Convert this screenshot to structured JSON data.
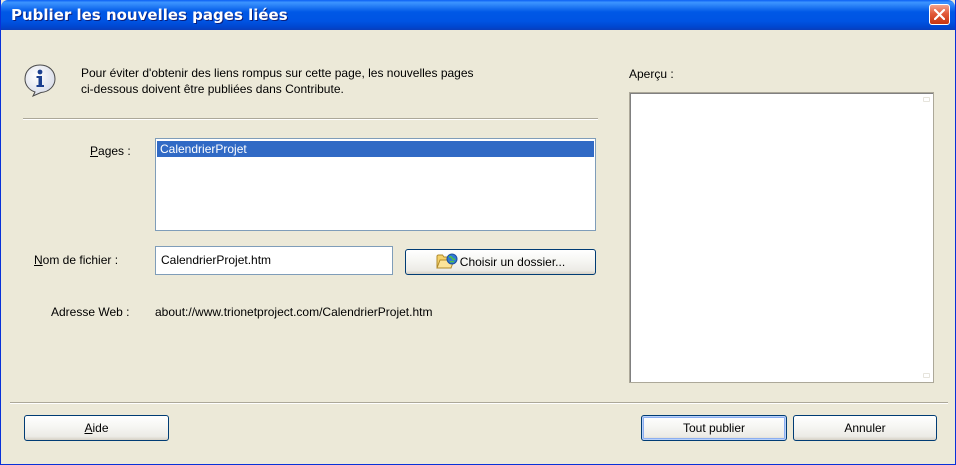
{
  "window": {
    "title": "Publier les nouvelles pages liées"
  },
  "message": {
    "line1": "Pour éviter d'obtenir des liens rompus sur cette page, les nouvelles pages",
    "line2": "ci-dessous doivent être publiées dans Contribute."
  },
  "pages": {
    "label_accel": "P",
    "label_rest": "ages :",
    "items": [
      "CalendrierProjet"
    ]
  },
  "filename": {
    "label_accel": "N",
    "label_rest": "om de fichier :",
    "value": "CalendrierProjet.htm",
    "choose_folder_label": "Choisir un dossier..."
  },
  "web_address": {
    "label": "Adresse Web :",
    "value": "about://www.trionetproject.com/CalendrierProjet.htm"
  },
  "preview": {
    "label": "Aperçu :"
  },
  "buttons": {
    "help_accel": "A",
    "help_rest": "ide",
    "publish_all": "Tout publier",
    "cancel": "Annuler"
  },
  "colors": {
    "titlebar": "#0054e3",
    "selection": "#316ac5",
    "dialog_bg": "#ece9d8",
    "close_button": "#e25a3a"
  }
}
